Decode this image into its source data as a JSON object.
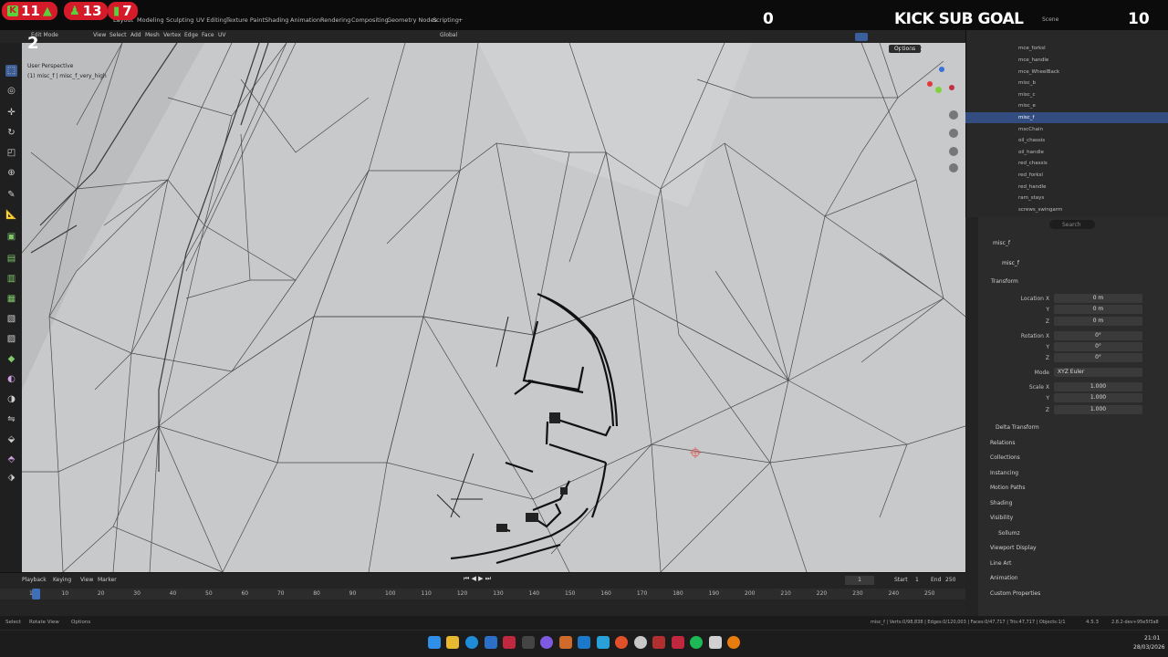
{
  "overlay": {
    "stats": [
      {
        "icon": "kick-icon",
        "value": "11",
        "arrow": "up"
      },
      {
        "icon": "users-icon",
        "value": "13"
      },
      {
        "icon": "bars-icon",
        "value": "7"
      }
    ],
    "twitch_count": "2",
    "kick_left_value": "0",
    "kick_sub_goal_label": "KICK SUB GOAL",
    "kick_sub_goal_value": "10"
  },
  "workspace_tabs": [
    "Layout",
    "Modeling",
    "Sculpting",
    "UV Editing",
    "Texture Paint",
    "Shading",
    "Animation",
    "Rendering",
    "Compositing",
    "Geometry Nodes",
    "Scripting",
    "+"
  ],
  "scene_label": "Scene",
  "header": {
    "mode": "Edit Mode",
    "menus": [
      "View",
      "Select",
      "Add",
      "Mesh",
      "Vertex",
      "Edge",
      "Face",
      "UV"
    ],
    "transform_orientation": "Global",
    "options_label": "Options",
    "axes": [
      "X",
      "Y",
      "Z"
    ]
  },
  "viewport": {
    "perspective_label": "User Perspective",
    "object_label": "(1) misc_f | misc_f_very_high"
  },
  "outliner": {
    "items": [
      {
        "name": "mce_forksl",
        "selected": false
      },
      {
        "name": "mce_handle",
        "selected": false
      },
      {
        "name": "mce_WheelBack",
        "selected": false
      },
      {
        "name": "misc_b",
        "selected": false
      },
      {
        "name": "misc_c",
        "selected": false
      },
      {
        "name": "misc_e",
        "selected": false
      },
      {
        "name": "misc_f",
        "selected": true
      },
      {
        "name": "mscChain",
        "selected": false
      },
      {
        "name": "oil_chassis",
        "selected": false
      },
      {
        "name": "oil_handle",
        "selected": false
      },
      {
        "name": "red_chassis",
        "selected": false
      },
      {
        "name": "red_forksl",
        "selected": false
      },
      {
        "name": "red_handle",
        "selected": false
      },
      {
        "name": "ram_stays",
        "selected": false
      },
      {
        "name": "screws_swingarm",
        "selected": false
      }
    ]
  },
  "properties": {
    "search_placeholder": "Search",
    "object_name": "misc_f",
    "object_name_field": "misc_f",
    "transform_header": "Transform",
    "location": {
      "label": "Location X",
      "x": "0 m",
      "y": "0 m",
      "z": "0 m"
    },
    "rotation": {
      "label": "Rotation X",
      "x": "0°",
      "y": "0°",
      "z": "0°"
    },
    "mode_label": "Mode",
    "mode_value": "XYZ Euler",
    "scale": {
      "label": "Scale X",
      "x": "1.000",
      "y": "1.000",
      "z": "1.000"
    },
    "axis_y": "Y",
    "axis_z": "Z",
    "sections": [
      "Delta Transform",
      "Relations",
      "Collections",
      "Instancing",
      "Motion Paths",
      "Shading",
      "Visibility",
      "Sollumz",
      "Viewport Display",
      "Line Art",
      "Animation",
      "Custom Properties"
    ]
  },
  "timeline": {
    "menus": [
      "Playback",
      "Keying",
      "View",
      "Marker"
    ],
    "current_frame": "1",
    "start_label": "Start",
    "start_value": "1",
    "end_label": "End",
    "end_value": "250",
    "ruler": [
      "1",
      "10",
      "20",
      "30",
      "40",
      "50",
      "60",
      "70",
      "80",
      "90",
      "100",
      "110",
      "120",
      "130",
      "140",
      "150",
      "160",
      "170",
      "180",
      "190",
      "200",
      "210",
      "220",
      "230",
      "240",
      "250"
    ]
  },
  "statusbar": {
    "left": [
      "Select",
      "Rotate View",
      "Options"
    ],
    "stats": "misc_f | Verts:0/98,838 | Edges:0/120,003 | Faces:0/47,717 | Tris:47,717 | Objects:1/1",
    "version": "4.5.3",
    "addon": "2.8.2-dev+95e5f3a8"
  },
  "taskbar": {
    "time": "21:01",
    "date": "28/03/2026"
  },
  "colors": {
    "accent_red": "#d51b2a",
    "selection_blue": "#334d80",
    "viewport_bg": "#c5c6c7"
  }
}
